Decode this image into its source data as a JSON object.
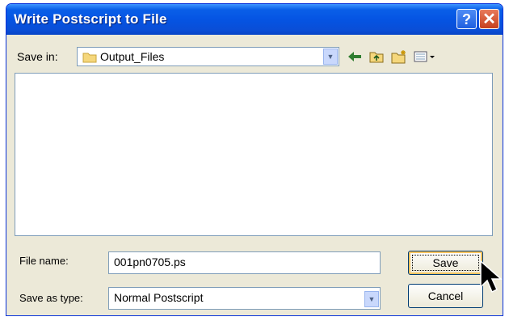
{
  "window": {
    "title": "Write Postscript to File",
    "help_label": "?",
    "close_label": "✕"
  },
  "toolbar": {
    "save_in_label": "Save in:",
    "save_in_value": "Output_Files",
    "icons": [
      "back-arrow-icon",
      "up-folder-icon",
      "new-folder-icon",
      "view-menu-icon"
    ]
  },
  "file_list": {
    "items": []
  },
  "form": {
    "file_name_label": "File name:",
    "file_name_value": "001pn0705.ps",
    "save_as_type_label": "Save as type:",
    "save_as_type_value": "Normal Postscript"
  },
  "buttons": {
    "save": "Save",
    "cancel": "Cancel"
  },
  "colors": {
    "title_bar": "#0554e3",
    "dialog_bg": "#ece9d8",
    "close": "#c6401f",
    "border": "#7f9db9"
  }
}
